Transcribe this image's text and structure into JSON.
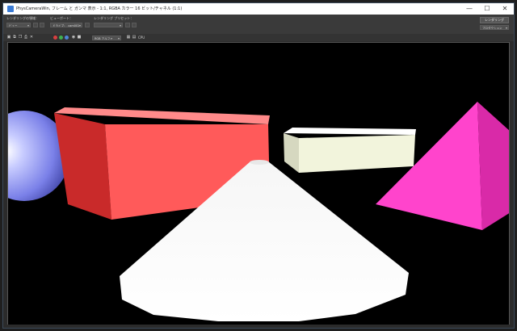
{
  "window": {
    "title": "PhysCameraWin, フレーム と ガンマ 表示 - 1:1, RGBA カラー 16 ビット/チャネル (1:1)",
    "minimize_glyph": "—",
    "maximize_glyph": "☐",
    "close_glyph": "✕"
  },
  "toolbar": {
    "render_area_label": "レンダリングの領域：",
    "render_area_value": "ビュー",
    "viewport_label": "ビューポート：",
    "viewport_value": "ドライブ：_cam001",
    "preset_label": "レンダリング プリセット：",
    "preset_value": "",
    "render_button": "レンダリング",
    "production_value": "プロダクション"
  },
  "toolbar2": {
    "channel_value": "RGB アルファ",
    "channel_value_label": "RGB アルファ",
    "cpu_label": "CPU"
  },
  "colors": {
    "red_dot": "#d94040",
    "green_dot": "#3fb04f",
    "blue_dot": "#4f86d9",
    "sphere": "#aab0ff",
    "box_red": "#ff5a5a",
    "box_white": "#f2f4dc",
    "pyramid": "#ff44cc",
    "cone": "#ffffff"
  },
  "icons": [
    "app-icon",
    "save-icon",
    "copy-icon",
    "clone-icon",
    "print-icon",
    "clear-icon",
    "lock-icon",
    "settings-icon",
    "frame-icon"
  ]
}
